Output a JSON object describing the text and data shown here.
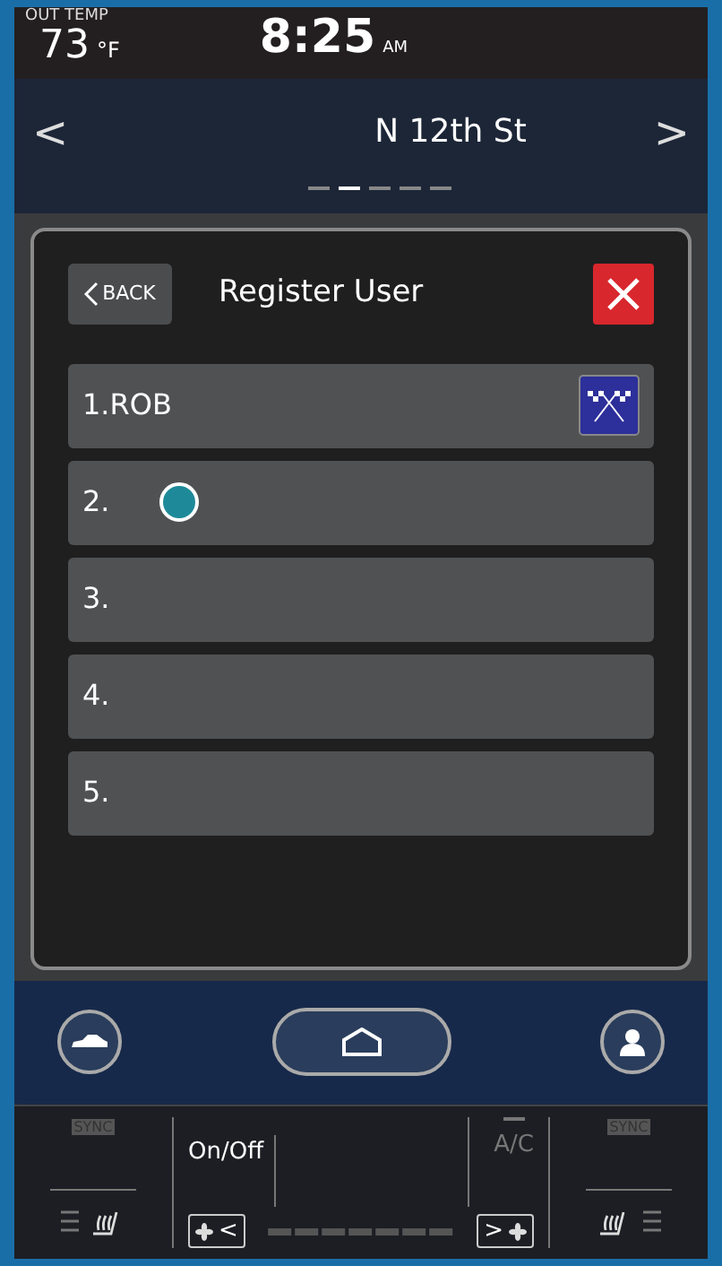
{
  "status_bar": {
    "out_temp_label": "OUT TEMP",
    "temperature": "73",
    "temperature_unit": "°F",
    "time": "8:25",
    "time_suffix": "AM"
  },
  "location": {
    "prev": "<",
    "name": "N 12th St",
    "next": ">",
    "pages": [
      {
        "selected": false
      },
      {
        "selected": true
      },
      {
        "selected": false
      },
      {
        "selected": false
      },
      {
        "selected": false
      }
    ]
  },
  "dialog": {
    "back": "BACK",
    "title": "Register User",
    "users": [
      {
        "label": "1.ROB",
        "kind": "flag"
      },
      {
        "label": "2.",
        "kind": "dot"
      },
      {
        "label": "3.",
        "kind": "empty"
      },
      {
        "label": "4.",
        "kind": "empty"
      },
      {
        "label": "5.",
        "kind": "empty"
      }
    ]
  },
  "climate": {
    "left_sync": "SYNC",
    "right_sync": "SYNC",
    "on_off": "On/Off",
    "ac": "A/C",
    "ac_on": false,
    "fan_down": "<",
    "fan_up": ">"
  }
}
